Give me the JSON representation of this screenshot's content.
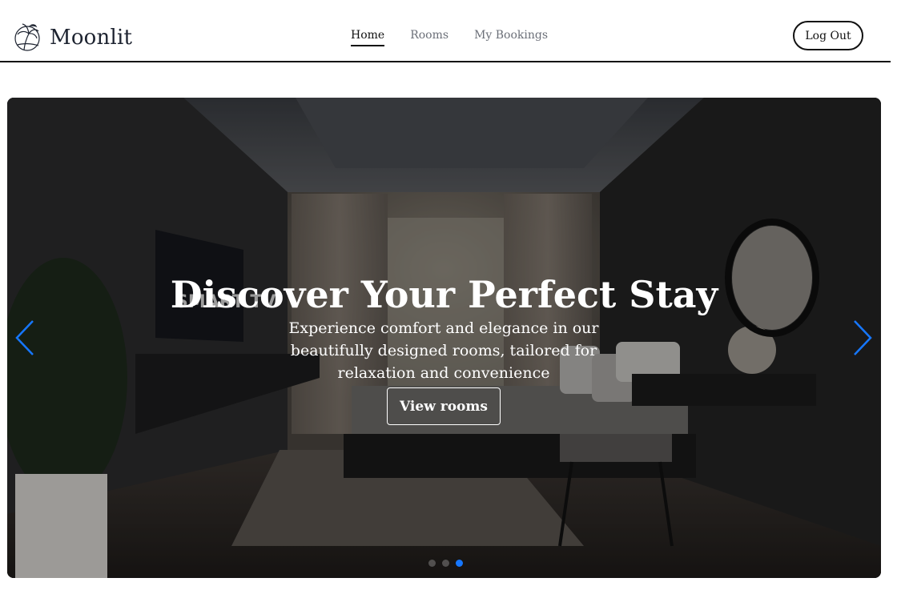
{
  "brand": {
    "name": "Moonlit",
    "logo_icon": "palm-moon-logo-icon"
  },
  "nav": {
    "items": [
      {
        "label": "Home",
        "active": true
      },
      {
        "label": "Rooms",
        "active": false
      },
      {
        "label": "My Bookings",
        "active": false
      }
    ]
  },
  "header": {
    "logout_label": "Log Out"
  },
  "hero": {
    "title": "Discover Your Perfect Stay",
    "subtitle": "Experience comfort and elegance in our beautifully designed rooms, tailored for relaxation and convenience",
    "cta_label": "View rooms",
    "prev_icon": "chevron-left-icon",
    "next_icon": "chevron-right-icon",
    "slide_count": 3,
    "active_slide": 3,
    "tv_text": "SMART TV"
  },
  "colors": {
    "accent": "#1677ff",
    "text": "#111111",
    "muted": "#6b6f78"
  }
}
